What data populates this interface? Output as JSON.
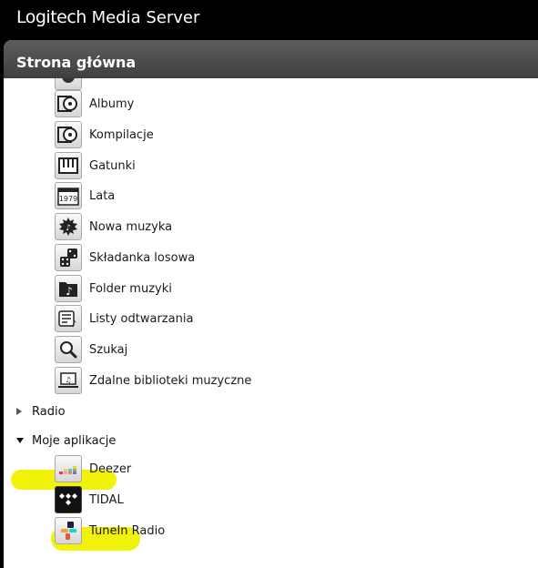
{
  "app": {
    "brand": "Logitech",
    "title_rest": " Media Server"
  },
  "panel": {
    "title": "Strona główna"
  },
  "music": {
    "items": [
      {
        "label": "Albumy",
        "icon": "album-icon"
      },
      {
        "label": "Kompilacje",
        "icon": "compilation-icon"
      },
      {
        "label": "Gatunki",
        "icon": "genres-icon"
      },
      {
        "label": "Lata",
        "icon": "years-icon"
      },
      {
        "label": "Nowa muzyka",
        "icon": "new-music-icon"
      },
      {
        "label": "Składanka losowa",
        "icon": "random-mix-icon"
      },
      {
        "label": "Folder muzyki",
        "icon": "music-folder-icon"
      },
      {
        "label": "Listy odtwarzania",
        "icon": "playlists-icon"
      },
      {
        "label": "Szukaj",
        "icon": "search-icon"
      },
      {
        "label": "Zdalne biblioteki muzyczne",
        "icon": "remote-libraries-icon"
      }
    ],
    "year_icon_text": "1979"
  },
  "categories": {
    "radio": {
      "label": "Radio",
      "expanded": false
    },
    "apps": {
      "label": "Moje aplikacje",
      "expanded": true
    }
  },
  "apps": {
    "items": [
      {
        "label": "Deezer",
        "icon": "deezer-icon"
      },
      {
        "label": "TIDAL",
        "icon": "tidal-icon"
      },
      {
        "label": "TuneIn Radio",
        "icon": "tunein-icon"
      }
    ]
  },
  "highlight_color": "#f1f20a"
}
